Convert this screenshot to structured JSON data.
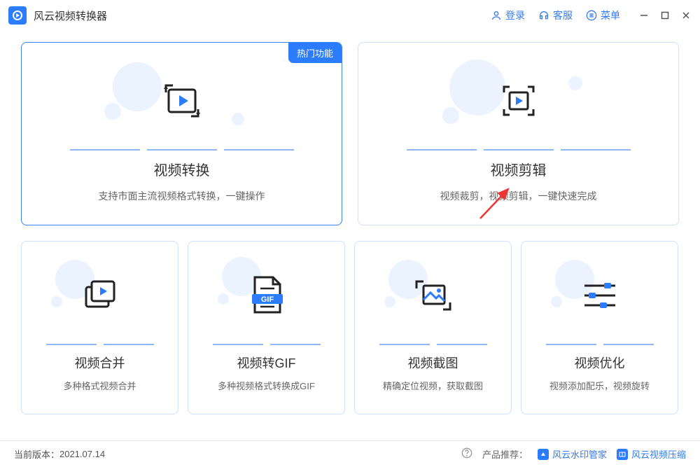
{
  "app": {
    "title": "风云视频转换器"
  },
  "header": {
    "login": "登录",
    "service": "客服",
    "menu": "菜单"
  },
  "cards": {
    "convert": {
      "badge": "热门功能",
      "title": "视频转换",
      "desc": "支持市面主流视频格式转换，一键操作"
    },
    "edit": {
      "title": "视频剪辑",
      "desc": "视频裁剪，视频剪辑，一键快速完成"
    },
    "merge": {
      "title": "视频合并",
      "desc": "多种格式视频合并"
    },
    "gif": {
      "title": "视频转GIF",
      "desc": "多种视频格式转换成GIF",
      "badge_text": "GIF"
    },
    "screenshot": {
      "title": "视频截图",
      "desc": "精确定位视频，获取截图"
    },
    "optimize": {
      "title": "视频优化",
      "desc": "视频添加配乐，视频旋转"
    }
  },
  "footer": {
    "version_label": "当前版本：",
    "version": "2021.07.14",
    "recommend_label": "产品推荐：",
    "prod1": "风云水印管家",
    "prod2": "风云视频压缩"
  }
}
